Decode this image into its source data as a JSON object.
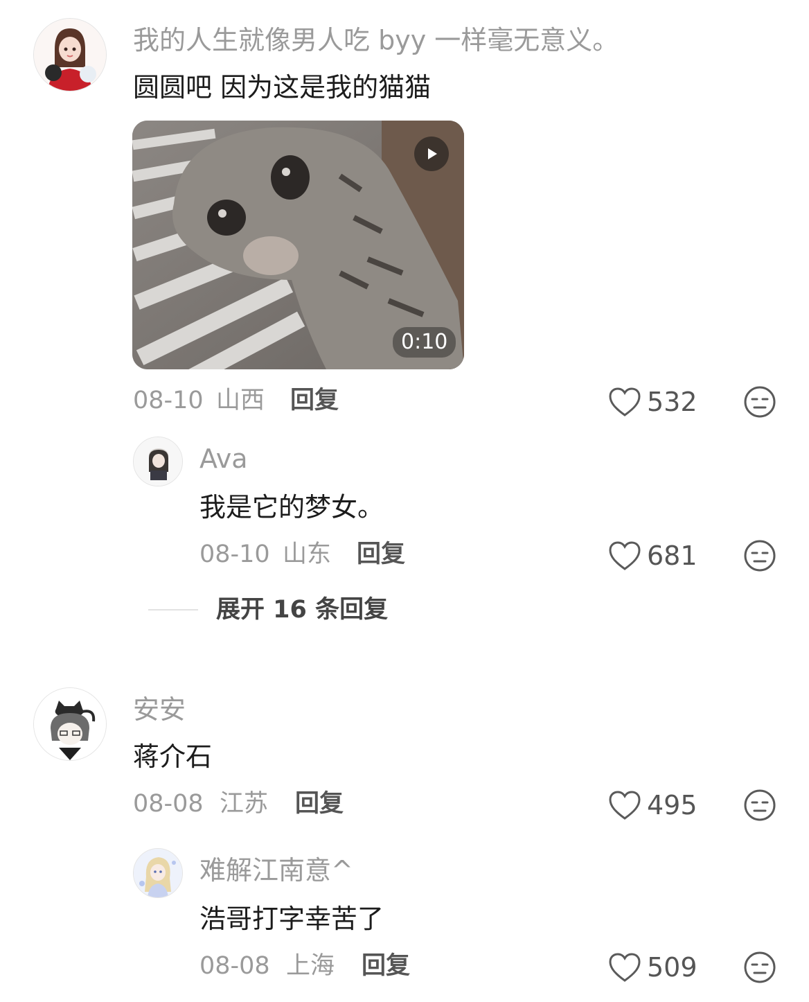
{
  "comments": [
    {
      "username": "我的人生就像男人吃 byy 一样毫无意义。",
      "text": "圆圆吧 因为这是我的猫猫",
      "video": {
        "duration": "0:10"
      },
      "date": "08-10",
      "location": "山西",
      "reply_label": "回复",
      "likes": "532",
      "replies": [
        {
          "username": "Ava",
          "text": "我是它的梦女。",
          "date": "08-10",
          "location": "山东",
          "reply_label": "回复",
          "likes": "681"
        }
      ],
      "expand_label": "展开 16 条回复"
    },
    {
      "username": "安安",
      "text": "蒋介石",
      "date": "08-08",
      "location": "江苏",
      "reply_label": "回复",
      "likes": "495",
      "replies": [
        {
          "username": "难解江南意^",
          "text": "浩哥打字幸苦了",
          "date": "08-08",
          "location": "上海",
          "reply_label": "回复",
          "likes": "509"
        }
      ]
    }
  ],
  "icons": {
    "like": "heart-outline-icon",
    "dislike": "neutral-face-icon",
    "play": "play-icon"
  },
  "colors": {
    "username": "#9a9a9a",
    "text": "#1c1c1c",
    "meta": "#9a9a9a",
    "action": "#555555",
    "background": "#ffffff"
  }
}
